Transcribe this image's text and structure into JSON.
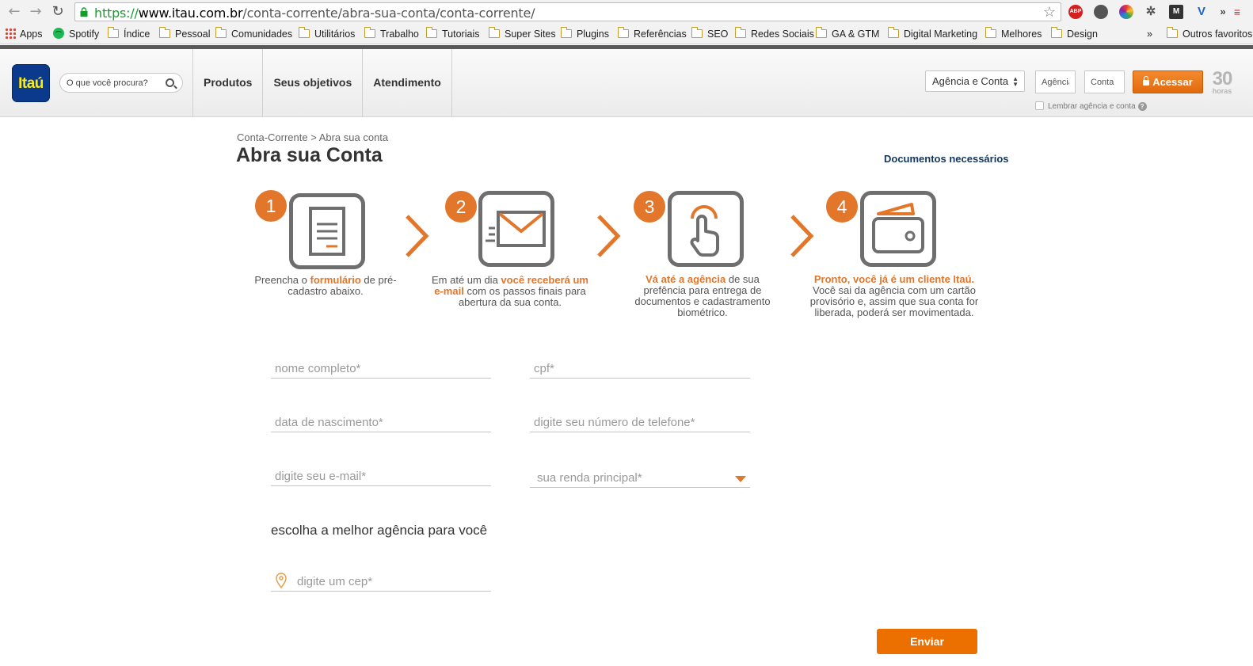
{
  "browser": {
    "url_scheme": "https://",
    "url_host": "www.itau.com.br",
    "url_path": "/conta-corrente/abra-sua-conta/conta-corrente/",
    "bookmarks": [
      {
        "label": "Apps",
        "type": "apps"
      },
      {
        "label": "Spotify",
        "type": "spotify"
      },
      {
        "label": "Índice",
        "type": "folder"
      },
      {
        "label": "Pessoal",
        "type": "folder"
      },
      {
        "label": "Comunidades",
        "type": "folder"
      },
      {
        "label": "Utilitários",
        "type": "folder"
      },
      {
        "label": "Trabalho",
        "type": "folder"
      },
      {
        "label": "Tutoriais",
        "type": "folder"
      },
      {
        "label": "Super Sites",
        "type": "folder"
      },
      {
        "label": "Plugins",
        "type": "folder"
      },
      {
        "label": "Referências",
        "type": "folder"
      },
      {
        "label": "SEO",
        "type": "folder"
      },
      {
        "label": "Redes Sociais",
        "type": "folder"
      },
      {
        "label": "GA & GTM",
        "type": "folder"
      },
      {
        "label": "Digital Marketing",
        "type": "folder"
      },
      {
        "label": "Melhores",
        "type": "folder"
      },
      {
        "label": "Design",
        "type": "folder"
      }
    ],
    "overflow_label": "»",
    "other_bookmarks": "Outros favoritos",
    "extension_abp": "ABP"
  },
  "header": {
    "logo_text": "Itaú",
    "search_placeholder": "O que você procura?",
    "nav": [
      "Produtos",
      "Seus objetivos",
      "Atendimento"
    ],
    "account_select": "Agência e Conta",
    "agencia_placeholder": "Agência",
    "conta_placeholder": "Conta",
    "acessar_label": "Acessar",
    "badge_number": "30",
    "badge_unit": "horas",
    "remember_label": "Lembrar agência e conta",
    "help_icon": "?"
  },
  "page": {
    "breadcrumb": "Conta-Corrente > Abra sua conta",
    "title": "Abra sua Conta",
    "docs_link": "Documentos necessários"
  },
  "steps": [
    {
      "number": "1",
      "icon": "form-icon",
      "pre": "Preencha o ",
      "hl": "formulário",
      "post": " de pré-cadastro abaixo."
    },
    {
      "number": "2",
      "icon": "email-icon",
      "pre": "Em até um dia ",
      "hl": "você receberá um e-mail",
      "post": " com os passos finais para abertura da sua conta."
    },
    {
      "number": "3",
      "icon": "touch-icon",
      "pre": "",
      "hl": "Vá até a agência",
      "post": " de sua prefência para entrega de documentos e cadastramento biométrico."
    },
    {
      "number": "4",
      "icon": "wallet-icon",
      "pre": "",
      "hl": "Pronto, você já é um cliente Itaú.",
      "post": " Você sai da agência com um cartão provisório e, assim que sua conta for liberada, poderá ser movimentada."
    }
  ],
  "form": {
    "nome_placeholder": "nome completo*",
    "cpf_placeholder": "cpf*",
    "nascimento_placeholder": "data de nascimento*",
    "telefone_placeholder": "digite seu número de telefone*",
    "email_placeholder": "digite seu e-mail*",
    "renda_placeholder": "sua renda principal*",
    "agencia_heading": "escolha a melhor agência para você",
    "cep_placeholder": "digite um cep*",
    "submit_label": "Enviar"
  },
  "colors": {
    "accent": "#e2762a",
    "brand_blue": "#0b3a8c",
    "brand_yellow": "#ffec00",
    "submit": "#ec7000"
  }
}
